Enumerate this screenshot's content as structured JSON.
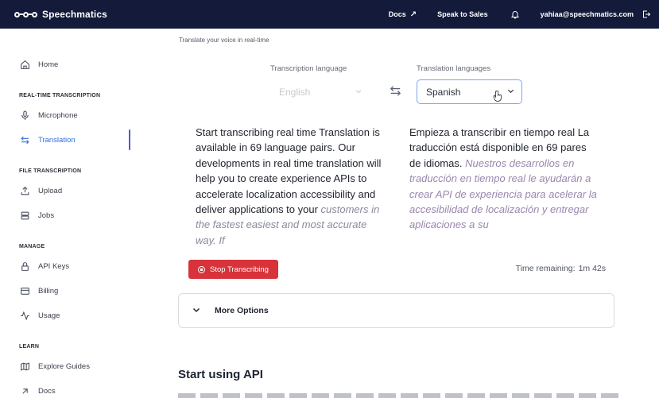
{
  "topbar": {
    "brand": "Speechmatics",
    "docs": "Docs",
    "sales": "Speak to Sales",
    "email": "yahiaa@speechmatics.com"
  },
  "sidebar": {
    "home": "Home",
    "section_realtime": "REAL-TIME TRANSCRIPTION",
    "microphone": "Microphone",
    "translation": "Translation",
    "section_file": "FILE TRANSCRIPTION",
    "upload": "Upload",
    "jobs": "Jobs",
    "section_manage": "MANAGE",
    "api_keys": "API Keys",
    "billing": "Billing",
    "usage": "Usage",
    "section_learn": "LEARN",
    "guides": "Explore Guides",
    "docs": "Docs"
  },
  "main": {
    "hint": "Translate your voice in real-time",
    "transcription_label": "Transcription language",
    "transcription_value": "English",
    "translation_label": "Translation languages",
    "translation_value": "Spanish",
    "english_final": "Start transcribing real time Translation is available in 69 language pairs. Our developments in real time translation will help you to create experience APIs to accelerate localization accessibility and deliver applications to your ",
    "english_partial": "customers in the fastest easiest and most accurate way. If",
    "spanish_final": "Empieza a transcribir en tiempo real La traducción está disponible en 69 pares de idiomas. ",
    "spanish_partial": "Nuestros desarrollos en traducción en tiempo real le ayudarán a crear API de experiencia para acelerar la accesibilidad de localización y entregar aplicaciones a su",
    "stop_button": "Stop Transcribing",
    "time_label": "Time remaining:",
    "time_value": "1m 42s",
    "more_options": "More Options",
    "api_heading": "Start using API"
  },
  "colors": {
    "topbar": "#141a3a",
    "accent": "#2f6fe0",
    "stop": "#d8323a"
  }
}
